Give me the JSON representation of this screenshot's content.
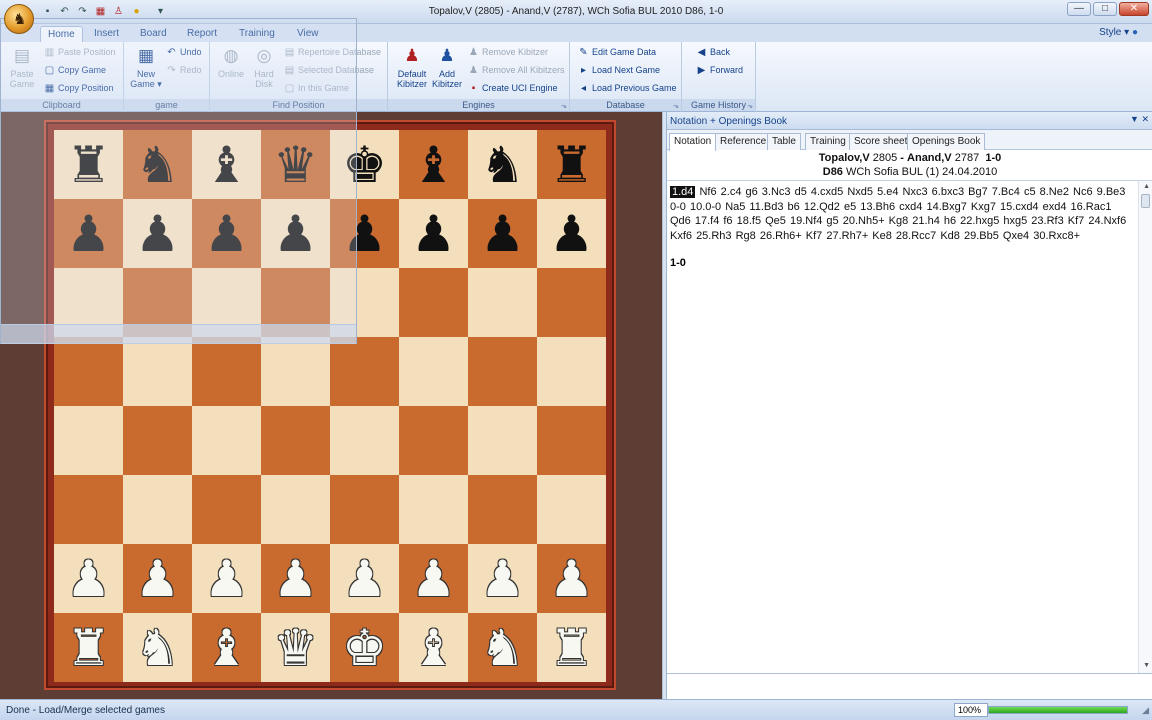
{
  "window": {
    "title": "Topalov,V (2805) - Anand,V (2787), WCh Sofia BUL 2010  D86, 1-0",
    "minimize": "—",
    "maximize": "□",
    "close": "✕"
  },
  "ribbon": {
    "tabs": [
      "Home",
      "Insert",
      "Board",
      "Report",
      "Training",
      "View"
    ],
    "active_tab": "Home",
    "style_label": "Style",
    "clipboard": {
      "label": "Clipboard",
      "paste_game": "Paste Game",
      "paste_position": "Paste Position",
      "copy_game": "Copy Game",
      "copy_position": "Copy Position"
    },
    "game": {
      "label": "game",
      "new_game": "New Game",
      "undo": "Undo",
      "redo": "Redo"
    },
    "find_position": {
      "label": "Find Position",
      "online": "Online",
      "hard_disk": "Hard Disk",
      "repertoire_database": "Repertoire Database",
      "selected_database": "Selected Database",
      "in_this_game": "In this Game"
    },
    "engines": {
      "label": "Engines",
      "default_kibitzer": "Default Kibitzer",
      "add_kibitzer": "Add Kibitzer",
      "remove_kibitzer": "Remove Kibitzer",
      "remove_all_kibitzers": "Remove All Kibitzers",
      "create_uci_engine": "Create UCI Engine"
    },
    "database": {
      "label": "Database",
      "edit_game_data": "Edit Game Data",
      "load_next_game": "Load Next Game",
      "load_previous_game": "Load Previous Game"
    },
    "game_history": {
      "label": "Game History",
      "back": "Back",
      "forward": "Forward"
    }
  },
  "board": {
    "ranks": [
      [
        "♜",
        "♞",
        "♝",
        "♛",
        "♚",
        "♝",
        "♞",
        "♜"
      ],
      [
        "♟",
        "♟",
        "♟",
        "♟",
        "♟",
        "♟",
        "♟",
        "♟"
      ],
      [
        "",
        "",
        "",
        "",
        "",
        "",
        "",
        ""
      ],
      [
        "",
        "",
        "",
        "",
        "",
        "",
        "",
        ""
      ],
      [
        "",
        "",
        "",
        "",
        "",
        "",
        "",
        ""
      ],
      [
        "",
        "",
        "",
        "",
        "",
        "",
        "",
        ""
      ],
      [
        "♙",
        "♙",
        "♙",
        "♙",
        "♙",
        "♙",
        "♙",
        "♙"
      ],
      [
        "♖",
        "♘",
        "♗",
        "♕",
        "♔",
        "♗",
        "♘",
        "♖"
      ]
    ],
    "colors": {
      "light": "#f4dfbd",
      "dark": "#c96a2e",
      "frame": "#8e2a1c"
    }
  },
  "notation": {
    "pane_title": "Notation + Openings Book",
    "tabs": [
      "Notation",
      "Reference",
      "Table",
      "Training",
      "Score sheet",
      "Openings Book"
    ],
    "active_tab": "Notation",
    "white": "Topalov,V",
    "white_elo": "2805",
    "black": "Anand,V",
    "black_elo": "2787",
    "result": "1-0",
    "eco": "D86",
    "event": "WCh Sofia BUL (1) 24.04.2010",
    "first_move": "1.d4",
    "moves": "Nf6  2.c4  g6  3.Nc3  d5  4.cxd5  Nxd5  5.e4  Nxc3  6.bxc3  Bg7  7.Bc4  c5  8.Ne2  Nc6  9.Be3  0-0  10.0-0  Na5  11.Bd3  b6  12.Qd2  e5  13.Bh6  cxd4  14.Bxg7  Kxg7  15.cxd4  exd4  16.Rac1  Qd6  17.f4  f6  18.f5  Qe5  19.Nf4  g5  20.Nh5+  Kg8  21.h4  h6  22.hxg5  hxg5  23.Rf3  Kf7  24.Nxf6  Kxf6  25.Rh3  Rg8  26.Rh6+  Kf7  27.Rh7+  Ke8  28.Rcc7  Kd8  29.Bb5  Qxe4  30.Rxc8+",
    "final_result": "1-0"
  },
  "status": {
    "text": "Done - Load/Merge selected games",
    "zoom": "100%",
    "progress": 1.0
  }
}
